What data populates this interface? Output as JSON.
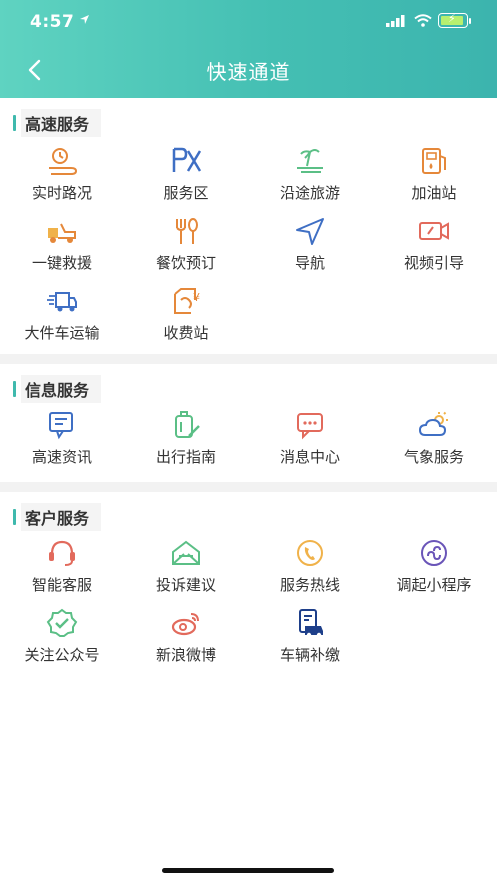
{
  "status_bar": {
    "time": "4:57"
  },
  "header": {
    "title": "快速通道"
  },
  "sections": [
    {
      "title": "高速服务",
      "items": [
        {
          "label": "实时路况",
          "icon": "road-condition-icon"
        },
        {
          "label": "服务区",
          "icon": "service-area-icon"
        },
        {
          "label": "沿途旅游",
          "icon": "tourism-icon"
        },
        {
          "label": "加油站",
          "icon": "gas-station-icon"
        },
        {
          "label": "一键救援",
          "icon": "rescue-truck-icon"
        },
        {
          "label": "餐饮预订",
          "icon": "dining-icon"
        },
        {
          "label": "导航",
          "icon": "navigation-icon"
        },
        {
          "label": "视频引导",
          "icon": "video-icon"
        },
        {
          "label": "大件车运输",
          "icon": "large-truck-icon"
        },
        {
          "label": "收费站",
          "icon": "toll-station-icon"
        }
      ]
    },
    {
      "title": "信息服务",
      "items": [
        {
          "label": "高速资讯",
          "icon": "news-icon"
        },
        {
          "label": "出行指南",
          "icon": "travel-guide-icon"
        },
        {
          "label": "消息中心",
          "icon": "message-icon"
        },
        {
          "label": "气象服务",
          "icon": "weather-icon"
        }
      ]
    },
    {
      "title": "客户服务",
      "items": [
        {
          "label": "智能客服",
          "icon": "headset-icon"
        },
        {
          "label": "投诉建议",
          "icon": "complaint-icon"
        },
        {
          "label": "服务热线",
          "icon": "hotline-icon"
        },
        {
          "label": "调起小程序",
          "icon": "mini-program-icon"
        },
        {
          "label": "关注公众号",
          "icon": "wechat-account-icon"
        },
        {
          "label": "新浪微博",
          "icon": "weibo-icon"
        },
        {
          "label": "车辆补缴",
          "icon": "vehicle-payment-icon"
        }
      ]
    }
  ],
  "colors": {
    "header_start": "#5fd3c1",
    "header_end": "#3cb4ae",
    "orange": "#e5883a",
    "blue": "#3f6fc4",
    "green": "#5bbf86",
    "red": "#e26a5c",
    "purple": "#6a55b8"
  }
}
